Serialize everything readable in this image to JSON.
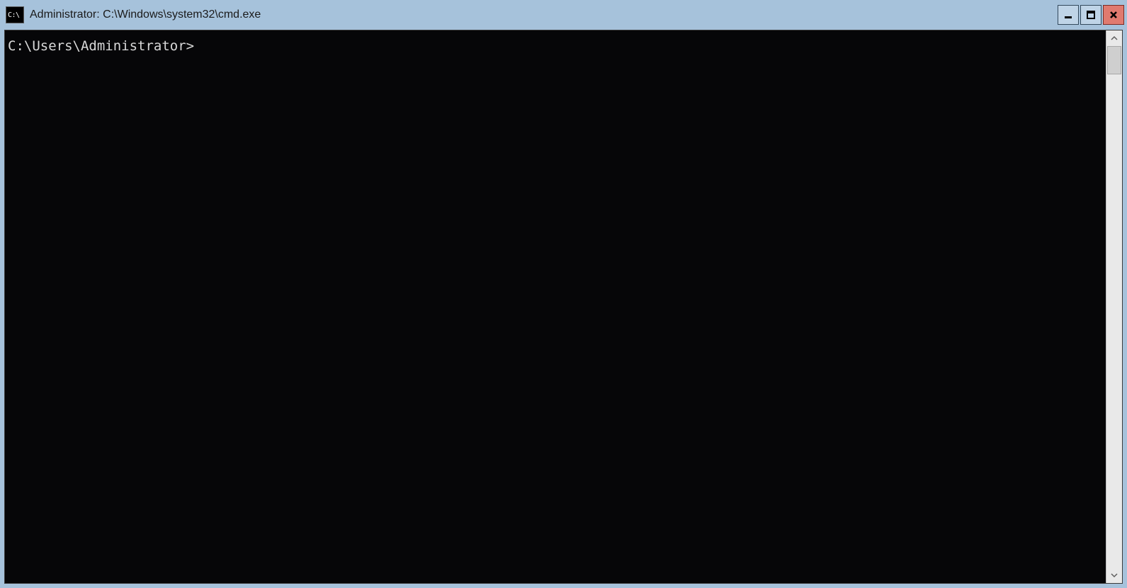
{
  "window": {
    "title": "Administrator: C:\\Windows\\system32\\cmd.exe",
    "icon_label": "C:\\"
  },
  "console": {
    "prompt": "C:\\Users\\Administrator>"
  }
}
